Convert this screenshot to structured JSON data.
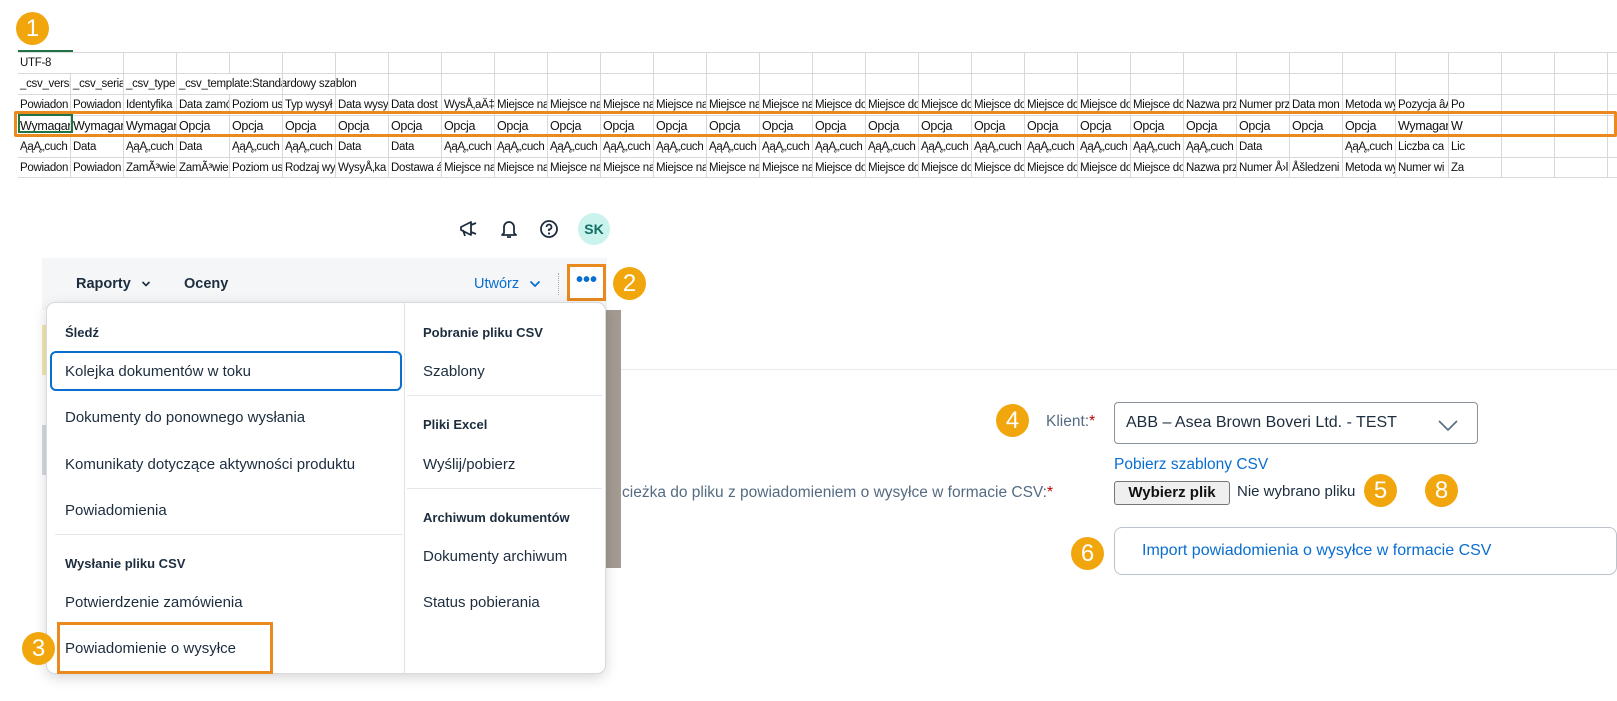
{
  "badges": [
    "1",
    "2",
    "3",
    "4",
    "5",
    "6",
    "8"
  ],
  "sheet": {
    "rows": [
      [
        "UTF-8"
      ],
      [
        "_csv_versi",
        "_csv_seria",
        "_csv_type",
        "_csv_template:Standardowy szablon"
      ],
      [
        "Powiadon",
        "Powiadon",
        "Identyfika",
        "Data zamó",
        "Poziom us",
        "Typ wysył",
        "Data wysy",
        "Data dost",
        "WysÅ‚aÄ‡",
        "Miejsce na",
        "Miejsce na",
        "Miejsce na",
        "Miejsce na",
        "Miejsce na",
        "Miejsce na",
        "Miejsce do",
        "Miejsce do",
        "Miejsce do",
        "Miejsce do",
        "Miejsce do",
        "Miejsce do",
        "Miejsce do",
        "Nazwa prz",
        "Numer prz",
        "Data mon",
        "Metoda wy",
        "Pozycja âĄ",
        "Po"
      ],
      [
        "Wymagan",
        "Wymagan",
        "Wymagan",
        "Opcja",
        "Opcja",
        "Opcja",
        "Opcja",
        "Opcja",
        "Opcja",
        "Opcja",
        "Opcja",
        "Opcja",
        "Opcja",
        "Opcja",
        "Opcja",
        "Opcja",
        "Opcja",
        "Opcja",
        "Opcja",
        "Opcja",
        "Opcja",
        "Opcja",
        "Opcja",
        "Opcja",
        "Opcja",
        "Opcja",
        "Wymagan",
        "W"
      ],
      [
        "ĄąĄ„cuch",
        "Data",
        "ĄąĄ„cuch",
        "Data",
        "ĄąĄ„cuch",
        "ĄąĄ„cuch",
        "Data",
        "Data",
        "ĄąĄ„cuch",
        "ĄąĄ„cuch",
        "ĄąĄ„cuch",
        "ĄąĄ„cuch",
        "ĄąĄ„cuch",
        "ĄąĄ„cuch",
        "ĄąĄ„cuch",
        "ĄąĄ„cuch",
        "ĄąĄ„cuch",
        "ĄąĄ„cuch",
        "ĄąĄ„cuch",
        "ĄąĄ„cuch",
        "ĄąĄ„cuch",
        "ĄąĄ„cuch",
        "ĄąĄ„cuch",
        "Data",
        "",
        "ĄąĄ„cuch",
        "Liczba ca",
        "Lic"
      ],
      [
        "Powiadon",
        "Powiadon",
        "ZamÃ³wie",
        "ZamÃ³wie",
        "Poziom us",
        "Rodzaj wy",
        "WysyÅ‚ka",
        "Dostawa á",
        "Miejsce na",
        "Miejsce na",
        "Miejsce na",
        "Miejsce na",
        "Miejsce na",
        "Miejsce na",
        "Miejsce na",
        "Miejsce do",
        "Miejsce do",
        "Miejsce do",
        "Miejsce do",
        "Miejsce do",
        "Miejsce do",
        "Miejsce do",
        "Nazwa prz",
        "Numer Å›l",
        "Åšledzeni",
        "Metoda wy",
        "Numer wi",
        "Za"
      ]
    ]
  },
  "shell": {
    "avatar": "SK",
    "icons": [
      "megaphone-icon",
      "bell-icon",
      "help-icon"
    ]
  },
  "nav": {
    "reports": "Raporty",
    "ratings": "Oceny",
    "create": "Utwórz",
    "more": "•••"
  },
  "menu": {
    "left": {
      "track_header": "Śledź",
      "track_items": [
        "Kolejka dokumentów w toku",
        "Dokumenty do ponownego wysłania",
        "Komunikaty dotyczące aktywności produktu",
        "Powiadomienia"
      ],
      "upload_header": "Wysłanie pliku CSV",
      "upload_items": [
        "Potwierdzenie zamówienia",
        "Powiadomienie o wysyłce"
      ]
    },
    "right": {
      "download_header": "Pobranie pliku CSV",
      "download_items": [
        "Szablony"
      ],
      "excel_header": "Pliki Excel",
      "excel_items": [
        "Wyślij/pobierz"
      ],
      "archive_header": "Archiwum dokumentów",
      "archive_items": [
        "Dokumenty archiwum",
        "Status pobierania"
      ]
    }
  },
  "form": {
    "client_label": "Klient:",
    "required_mark": "*",
    "client_value": "ABB – Asea Brown Boveri Ltd. - TEST",
    "templates_link": "Pobierz szablony CSV",
    "file_label": "cieżka do pliku z powiadomieniem o wysyłce w formacie CSV:",
    "file_button": "Wybierz plik",
    "file_status": "Nie wybrano pliku",
    "import_button": "Import powiadomienia o wysyłce w formacie CSV"
  },
  "colors": {
    "accent": "#0a6ed1",
    "highlight": "#e9891f",
    "badge": "#f2a60e",
    "excel_green": "#217346"
  }
}
